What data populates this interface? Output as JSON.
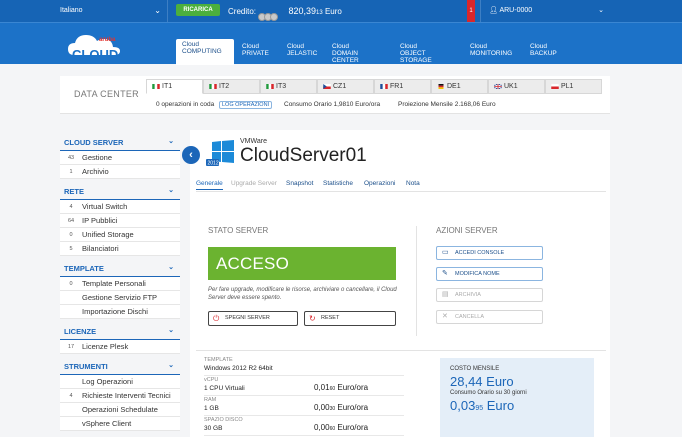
{
  "topbar": {
    "language": "Italiano",
    "recharge_label": "RICARICA",
    "credit_label": "Credito:",
    "credit_amount": "820,39",
    "credit_cents": "13",
    "credit_currency": "Euro",
    "notification_count": "1",
    "user": "ARU-0000"
  },
  "logo": {
    "small_text": "aruba",
    "big_text": "CLOUD"
  },
  "nav_tabs": [
    {
      "line1": "Cloud",
      "line2": "COMPUTING"
    },
    {
      "line1": "Cloud",
      "line2": "PRIVATE"
    },
    {
      "line1": "Cloud",
      "line2": "JELASTIC"
    },
    {
      "line1": "Cloud",
      "line2": "DOMAIN CENTER"
    },
    {
      "line1": "Cloud",
      "line2": "OBJECT STORAGE"
    },
    {
      "line1": "Cloud",
      "line2": "MONITORING"
    },
    {
      "line1": "Cloud",
      "line2": "BACKUP"
    }
  ],
  "datacenter": {
    "label": "DATA CENTER",
    "tabs": [
      {
        "label": "IT1",
        "flag": "it"
      },
      {
        "label": "IT2",
        "flag": "it"
      },
      {
        "label": "IT3",
        "flag": "it"
      },
      {
        "label": "CZ1",
        "flag": "cz"
      },
      {
        "label": "FR1",
        "flag": "fr"
      },
      {
        "label": "DE1",
        "flag": "de"
      },
      {
        "label": "UK1",
        "flag": "uk"
      },
      {
        "label": "PL1",
        "flag": "pl"
      }
    ],
    "queue_text": "0 operazioni in coda",
    "log_label": "LOG OPERAZIONI",
    "hourly_label": "Consumo Orario",
    "hourly_value": "1,9810 Euro/ora",
    "monthly_label": "Proiezione Mensile",
    "monthly_value": "2.168,06 Euro"
  },
  "sidebar": {
    "sections": [
      {
        "title": "CLOUD SERVER",
        "items": [
          {
            "count": "43",
            "label": "Gestione"
          },
          {
            "count": "1",
            "label": "Archivio"
          }
        ]
      },
      {
        "title": "RETE",
        "items": [
          {
            "count": "4",
            "label": "Virtual Switch"
          },
          {
            "count": "64",
            "label": "IP Pubblici"
          },
          {
            "count": "0",
            "label": "Unified Storage"
          },
          {
            "count": "5",
            "label": "Bilanciatori"
          }
        ]
      },
      {
        "title": "TEMPLATE",
        "items": [
          {
            "count": "0",
            "label": "Template Personali"
          },
          {
            "count": "",
            "label": "Gestione Servizio FTP"
          },
          {
            "count": "",
            "label": "Importazione Dischi"
          }
        ]
      },
      {
        "title": "LICENZE",
        "items": [
          {
            "count": "17",
            "label": "Licenze Plesk"
          }
        ]
      },
      {
        "title": "STRUMENTI",
        "items": [
          {
            "count": "",
            "label": "Log Operazioni"
          },
          {
            "count": "4",
            "label": "Richieste Interventi Tecnici"
          },
          {
            "count": "",
            "label": "Operazioni Schedulate"
          },
          {
            "count": "",
            "label": "vSphere Client"
          }
        ]
      }
    ]
  },
  "server": {
    "vendor": "VMWare",
    "name": "CloudServer01",
    "os_badge": "2012",
    "subtabs": [
      {
        "label": "Generale",
        "state": "active"
      },
      {
        "label": "Upgrade Server",
        "state": "disabled"
      },
      {
        "label": "Snapshot",
        "state": "normal"
      },
      {
        "label": "Statistiche",
        "state": "normal"
      },
      {
        "label": "Operazioni",
        "state": "normal"
      },
      {
        "label": "Nota",
        "state": "normal"
      }
    ],
    "status_title": "STATO SERVER",
    "status": "ACCESO",
    "status_note": "Per fare upgrade, modificare le risorse, archiviare o cancellare, il Cloud Server deve essere spento.",
    "shutdown_label": "SPEGNI SERVER",
    "reset_label": "RESET",
    "actions_title": "AZIONI SERVER",
    "actions": [
      {
        "label": "ACCEDI CONSOLE",
        "enabled": true,
        "icon": "monitor-icon"
      },
      {
        "label": "MODIFICA NOME",
        "enabled": true,
        "icon": "edit-icon"
      },
      {
        "label": "ARCHIVIA",
        "enabled": false,
        "icon": "archive-icon"
      },
      {
        "label": "CANCELLA",
        "enabled": false,
        "icon": "delete-icon"
      }
    ],
    "specs": [
      {
        "label": "TEMPLATE",
        "value": "Windows 2012 R2 64bit",
        "price": "",
        "price_cents": "",
        "price_unit": ""
      },
      {
        "label": "vCPU",
        "value": "1 CPU Virtuali",
        "price": "0,01",
        "price_cents": "60",
        "price_unit": "Euro/ora"
      },
      {
        "label": "RAM",
        "value": "1 GB",
        "price": "0,00",
        "price_cents": "30",
        "price_unit": "Euro/ora"
      },
      {
        "label": "SPAZIO DISCO",
        "value": "30 GB",
        "price": "0,00",
        "price_cents": "60",
        "price_unit": "Euro/ora"
      }
    ],
    "cost": {
      "title": "COSTO MENSILE",
      "monthly": "28,44 Euro",
      "note": "Consumo Orario su 30 giorni",
      "hourly_main": "0,03",
      "hourly_cents": "95",
      "hourly_unit": "Euro"
    }
  },
  "colors": {
    "topbar": "#1664b5",
    "header": "#1c72c8",
    "accent": "#1c66b8",
    "status_on": "#6bb330",
    "recharge": "#4caf3d",
    "notification": "#d9262b"
  }
}
